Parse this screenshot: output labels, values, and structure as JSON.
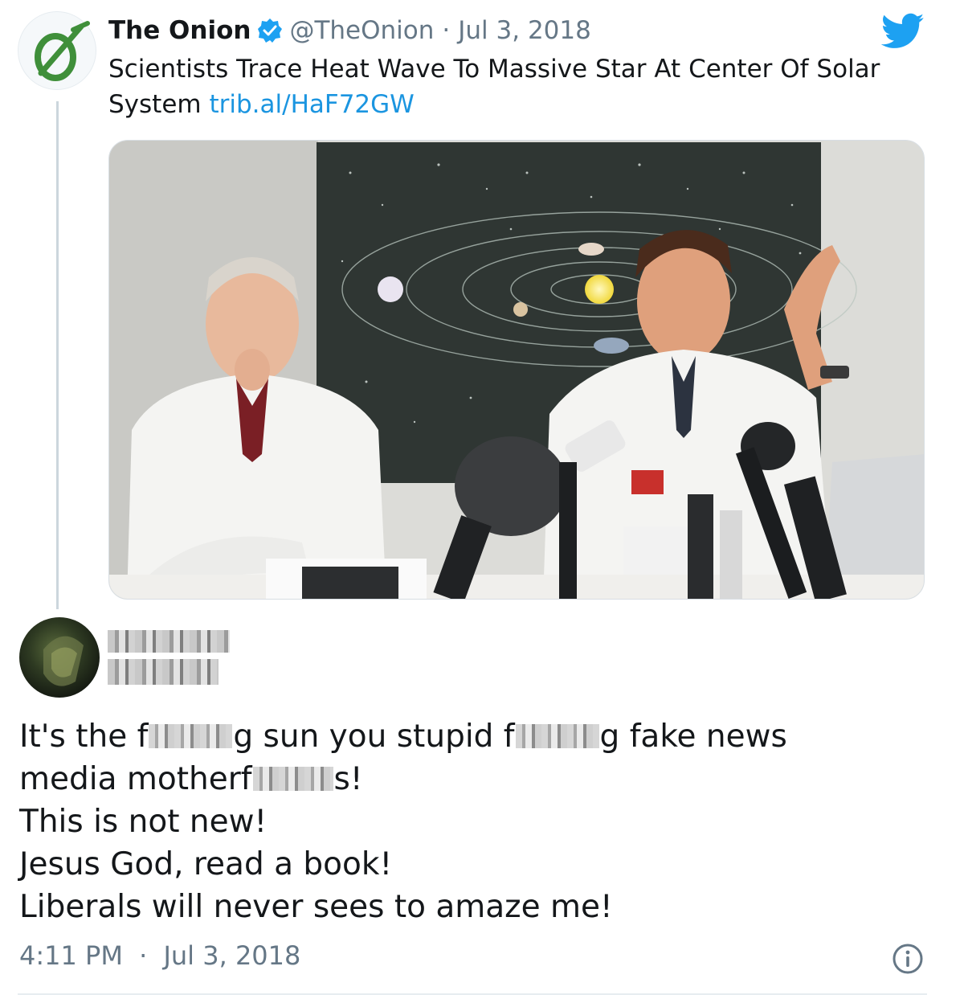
{
  "quoted_tweet": {
    "author_name": "The Onion",
    "handle": "@TheOnion",
    "separator": "·",
    "date": "Jul 3, 2018",
    "text": "Scientists Trace Heat Wave To Massive Star At Center Of Solar System",
    "link": "trib.al/HaF72GW",
    "avatar_icon": "onion-logo-icon",
    "verified_icon": "verified-badge-icon",
    "platform_icon": "twitter-bird-icon"
  },
  "reply": {
    "lines": [
      [
        "It's the f",
        "g sun you stupid f",
        "g fake news"
      ],
      [
        "media motherf",
        "s!"
      ],
      [
        "This is not new!"
      ],
      [
        "Jesus God, read a book!"
      ],
      [
        "Liberals will never sees to amaze me!"
      ]
    ],
    "time": "4:11 PM",
    "separator": "·",
    "date": "Jul 3, 2018",
    "info_icon": "info-icon"
  },
  "colors": {
    "link_blue": "#1b95e0",
    "secondary_text": "#657786",
    "twitter_blue": "#1da1f2",
    "onion_green": "#3f8f3a"
  }
}
